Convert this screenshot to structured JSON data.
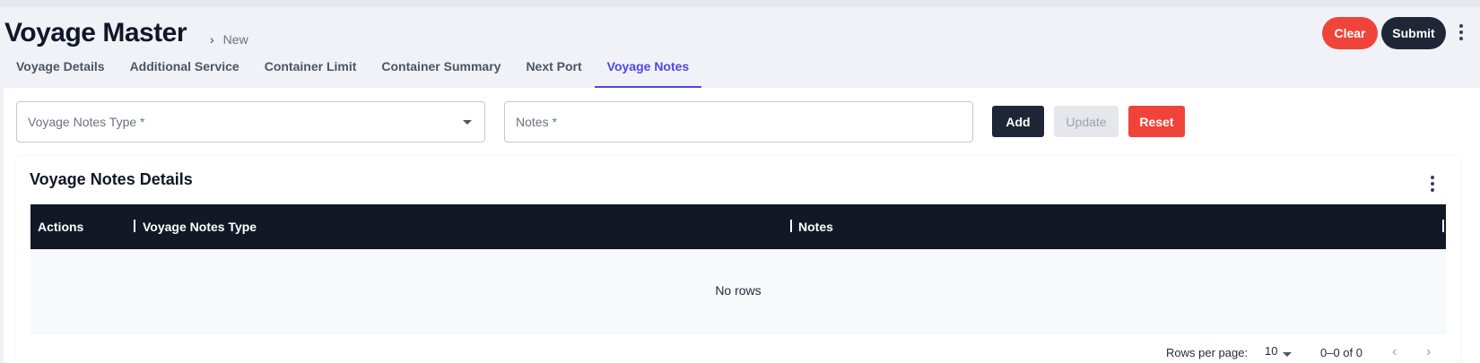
{
  "header": {
    "title": "Voyage Master",
    "breadcrumb_separator": "›",
    "breadcrumb_current": "New",
    "clear_label": "Clear",
    "submit_label": "Submit",
    "menu_icon": "more-vertical-icon"
  },
  "tabs": [
    {
      "label": "Voyage Details",
      "active": false
    },
    {
      "label": "Additional Service",
      "active": false
    },
    {
      "label": "Container Limit",
      "active": false
    },
    {
      "label": "Container Summary",
      "active": false
    },
    {
      "label": "Next Port",
      "active": false
    },
    {
      "label": "Voyage Notes",
      "active": true
    }
  ],
  "form": {
    "notes_type_label": "Voyage Notes Type *",
    "notes_label": "Notes *",
    "add_label": "Add",
    "update_label": "Update",
    "reset_label": "Reset"
  },
  "table": {
    "title": "Voyage Notes Details",
    "columns": [
      "Actions",
      "Voyage Notes Type",
      "Notes"
    ],
    "empty_text": "No rows",
    "rows_per_page_label": "Rows per page:",
    "rows_per_page_value": "10",
    "pagination_text": "0–0 of 0",
    "prev_icon": "chevron-left-icon",
    "next_icon": "chevron-right-icon"
  },
  "colors": {
    "accent": "#4f46e5",
    "danger": "#f0443a",
    "dark": "#1e2638",
    "table_header": "#121826"
  }
}
